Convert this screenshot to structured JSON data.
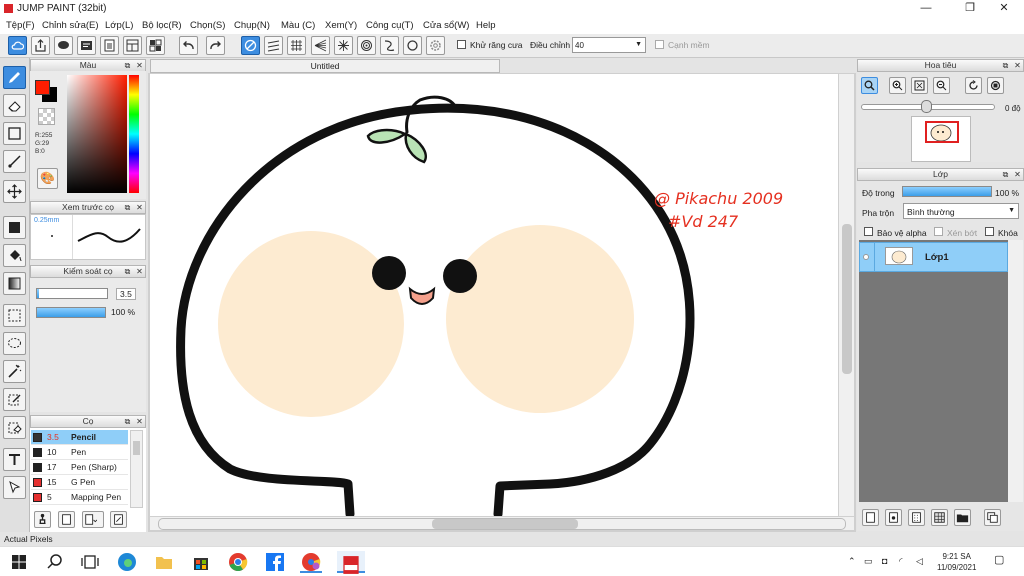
{
  "window": {
    "title": "JUMP PAINT (32bit)"
  },
  "menu": [
    "Tệp(F)",
    "Chỉnh sửa(E)",
    "Lớp(L)",
    "Bộ lọc(R)",
    "Chọn(S)",
    "Chụp(N)",
    "Màu (C)",
    "Xem(Y)",
    "Công cụ(T)",
    "Cửa sổ(W)",
    "Help"
  ],
  "toolbar": {
    "antialias_label": "Khử răng cưa",
    "adjust_label": "Điều chỉnh",
    "adjust_value": "40",
    "edge_label": "Cạnh mềm"
  },
  "color_panel": {
    "title": "Màu",
    "r": "R:255",
    "g": "G:29",
    "b": "B:0",
    "foreground": "#ff1d00",
    "background": "#000000"
  },
  "preview_panel": {
    "title": "Xem trước cọ",
    "size": "0.25mm"
  },
  "control_panel": {
    "title": "Kiểm soát cọ",
    "size_value": "3.5",
    "opacity_value": "100 %",
    "opacity_fraction": 1.0
  },
  "brush_panel": {
    "title": "Cọ",
    "brushes": [
      {
        "size": "3.5",
        "name": "Pencil",
        "color": "#333333"
      },
      {
        "size": "10",
        "name": "Pen",
        "color": "#222222"
      },
      {
        "size": "17",
        "name": "Pen (Sharp)",
        "color": "#222222"
      },
      {
        "size": "15",
        "name": "G Pen",
        "color": "#e53030"
      },
      {
        "size": "5",
        "name": "Mapping Pen",
        "color": "#e53030"
      }
    ]
  },
  "canvas": {
    "tab_title": "Untitled",
    "signature_line1": "@ Pikachu 2009",
    "signature_line2": "#Vd 247"
  },
  "navigator": {
    "title": "Hoa tiêu",
    "angle": "0 độ"
  },
  "layer_panel": {
    "title": "Lớp",
    "opacity_label": "Độ trong",
    "opacity_value": "100 %",
    "opacity_fraction": 1.0,
    "blend_label": "Pha trộn",
    "blend_value": "Bình thường",
    "protect_alpha": "Bảo vệ alpha",
    "clip": "Xén bớt",
    "lock": "Khóa",
    "layer_name": "Lớp1"
  },
  "status": {
    "text": "Actual Pixels"
  },
  "taskbar": {
    "time": "9:21 SA",
    "date": "11/09/2021"
  },
  "colors": {
    "accent": "#3d8de0",
    "selection": "#8fcef8",
    "cheek": "#fdebd1"
  }
}
